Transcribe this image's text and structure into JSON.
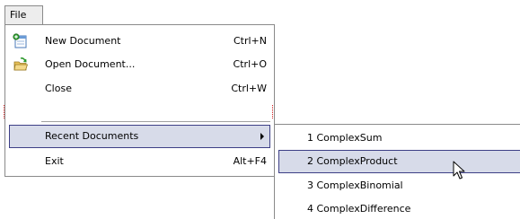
{
  "menubar": {
    "file_label": "File"
  },
  "file_menu": {
    "new_document": {
      "label": "New Document",
      "shortcut": "Ctrl+N",
      "icon": "new-document-icon"
    },
    "open_document": {
      "label": "Open Document...",
      "shortcut": "Ctrl+O",
      "icon": "open-document-icon"
    },
    "close": {
      "label": "Close",
      "shortcut": "Ctrl+W"
    },
    "recent_documents": {
      "label": "Recent Documents"
    },
    "exit": {
      "label": "Exit",
      "shortcut": "Alt+F4"
    }
  },
  "recent_submenu": {
    "items": [
      {
        "label": "1  ComplexSum"
      },
      {
        "label": "2  ComplexProduct"
      },
      {
        "label": "3  ComplexBinomial"
      },
      {
        "label": "4  ComplexDifference"
      }
    ],
    "highlighted_index": 1
  },
  "colors": {
    "selection_fill": "#d7dbe9",
    "selection_border": "#3d3f86",
    "menu_border": "#8a8a8a"
  }
}
